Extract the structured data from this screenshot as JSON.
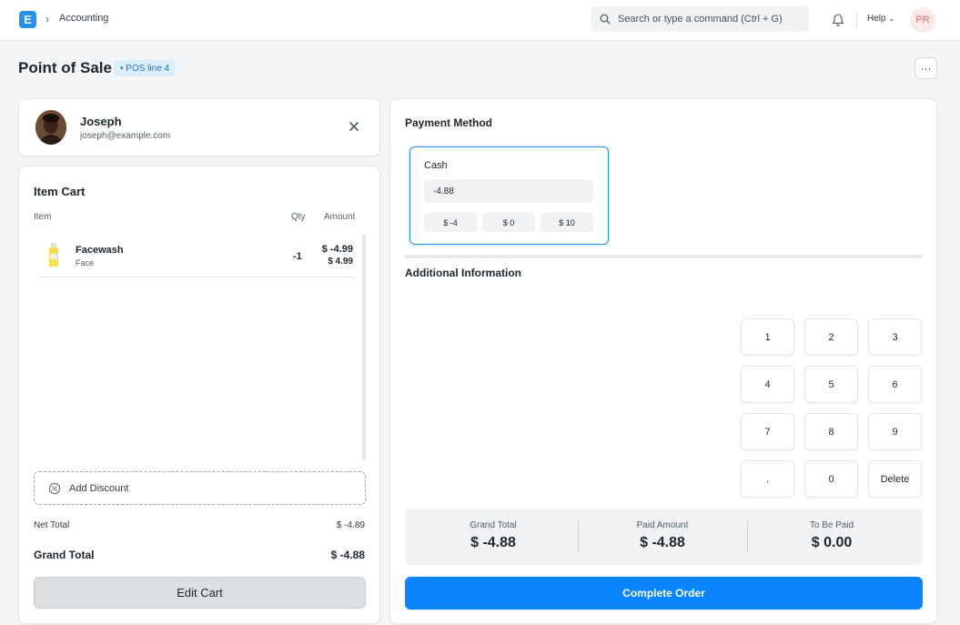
{
  "navbar": {
    "logo": "E",
    "breadcrumb": "Accounting",
    "search_placeholder": "Search or type a command (Ctrl + G)",
    "help": "Help",
    "user_initials": "PR"
  },
  "page": {
    "title": "Point of Sale",
    "status": "• POS line 4",
    "more": "···"
  },
  "customer": {
    "name": "Joseph",
    "email": "joseph@example.com"
  },
  "cart": {
    "title": "Item Cart",
    "columns": {
      "item": "Item",
      "qty": "Qty",
      "amount": "Amount"
    },
    "items": [
      {
        "name": "Facewash",
        "group": "Face",
        "qty": "-1",
        "amount": "$ -4.99",
        "rate": "$ 4.99"
      }
    ],
    "add_discount": "Add Discount",
    "net_total_label": "Net Total",
    "net_total": "$ -4.89",
    "grand_total_label": "Grand Total",
    "grand_total": "$ -4.88",
    "edit_cart": "Edit Cart"
  },
  "payment": {
    "title": "Payment Method",
    "mode": {
      "label": "Cash",
      "amount": "-4.88",
      "shortcuts": [
        "$ -4",
        "$ 0",
        "$ 10"
      ]
    },
    "additional_info": "Additional Information",
    "numpad": [
      "1",
      "2",
      "3",
      "4",
      "5",
      "6",
      "7",
      "8",
      "9",
      ".",
      "0",
      "Delete"
    ],
    "totals": [
      {
        "label": "Grand Total",
        "value": "$ -4.88"
      },
      {
        "label": "Paid Amount",
        "value": "$ -4.88"
      },
      {
        "label": "To Be Paid",
        "value": "$ 0.00"
      }
    ],
    "complete_order": "Complete Order"
  },
  "colors": {
    "primary": "#0a84ff",
    "accent_border": "#2490ef",
    "badge_bg": "#dbeefe",
    "badge_text": "#2270c4"
  },
  "icons": [
    "search-icon",
    "bell-icon",
    "chevron-down-icon",
    "close-icon",
    "discount-icon",
    "more-icon"
  ]
}
